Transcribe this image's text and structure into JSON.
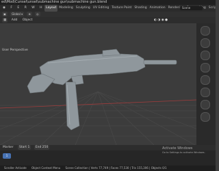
{
  "window": {
    "title": "ed\\Mod\\Cunsel\\unsel\\submachine gun\\submachine gun.blend",
    "scene_label": "Scene",
    "scene_field": "Scene"
  },
  "menubar": {
    "workspaces": [
      "Layout",
      "Modeling",
      "Sculpting",
      "UV Editing",
      "Texture Paint",
      "Shading",
      "Animation",
      "Rendering",
      "Compositing",
      "Scripting"
    ],
    "active": "Layout"
  },
  "toolbar": {
    "transform_orientation": "Global",
    "view_label": "Add",
    "object_label": "Object"
  },
  "timeline": {
    "marker_label": "Marker",
    "frame_start": "1",
    "frame_end": "250",
    "current_frame": "1"
  },
  "statusbar": {
    "left": "Scroller Activate",
    "mid": "Object Context Menu",
    "right": "Scene Collection | Verts 77,749 | Faces 77,530 | Tris 155,306 | Objects 0/1"
  },
  "watermark": {
    "line1": "Activate Windows",
    "line2": "Go to Settings to activate Windows."
  },
  "colors": {
    "accent": "#4772b3",
    "gun_body": "#8f979c",
    "grid_line": "#4a4a4a",
    "x_axis": "#a13c3c",
    "y_axis": "#6c8f2b"
  }
}
